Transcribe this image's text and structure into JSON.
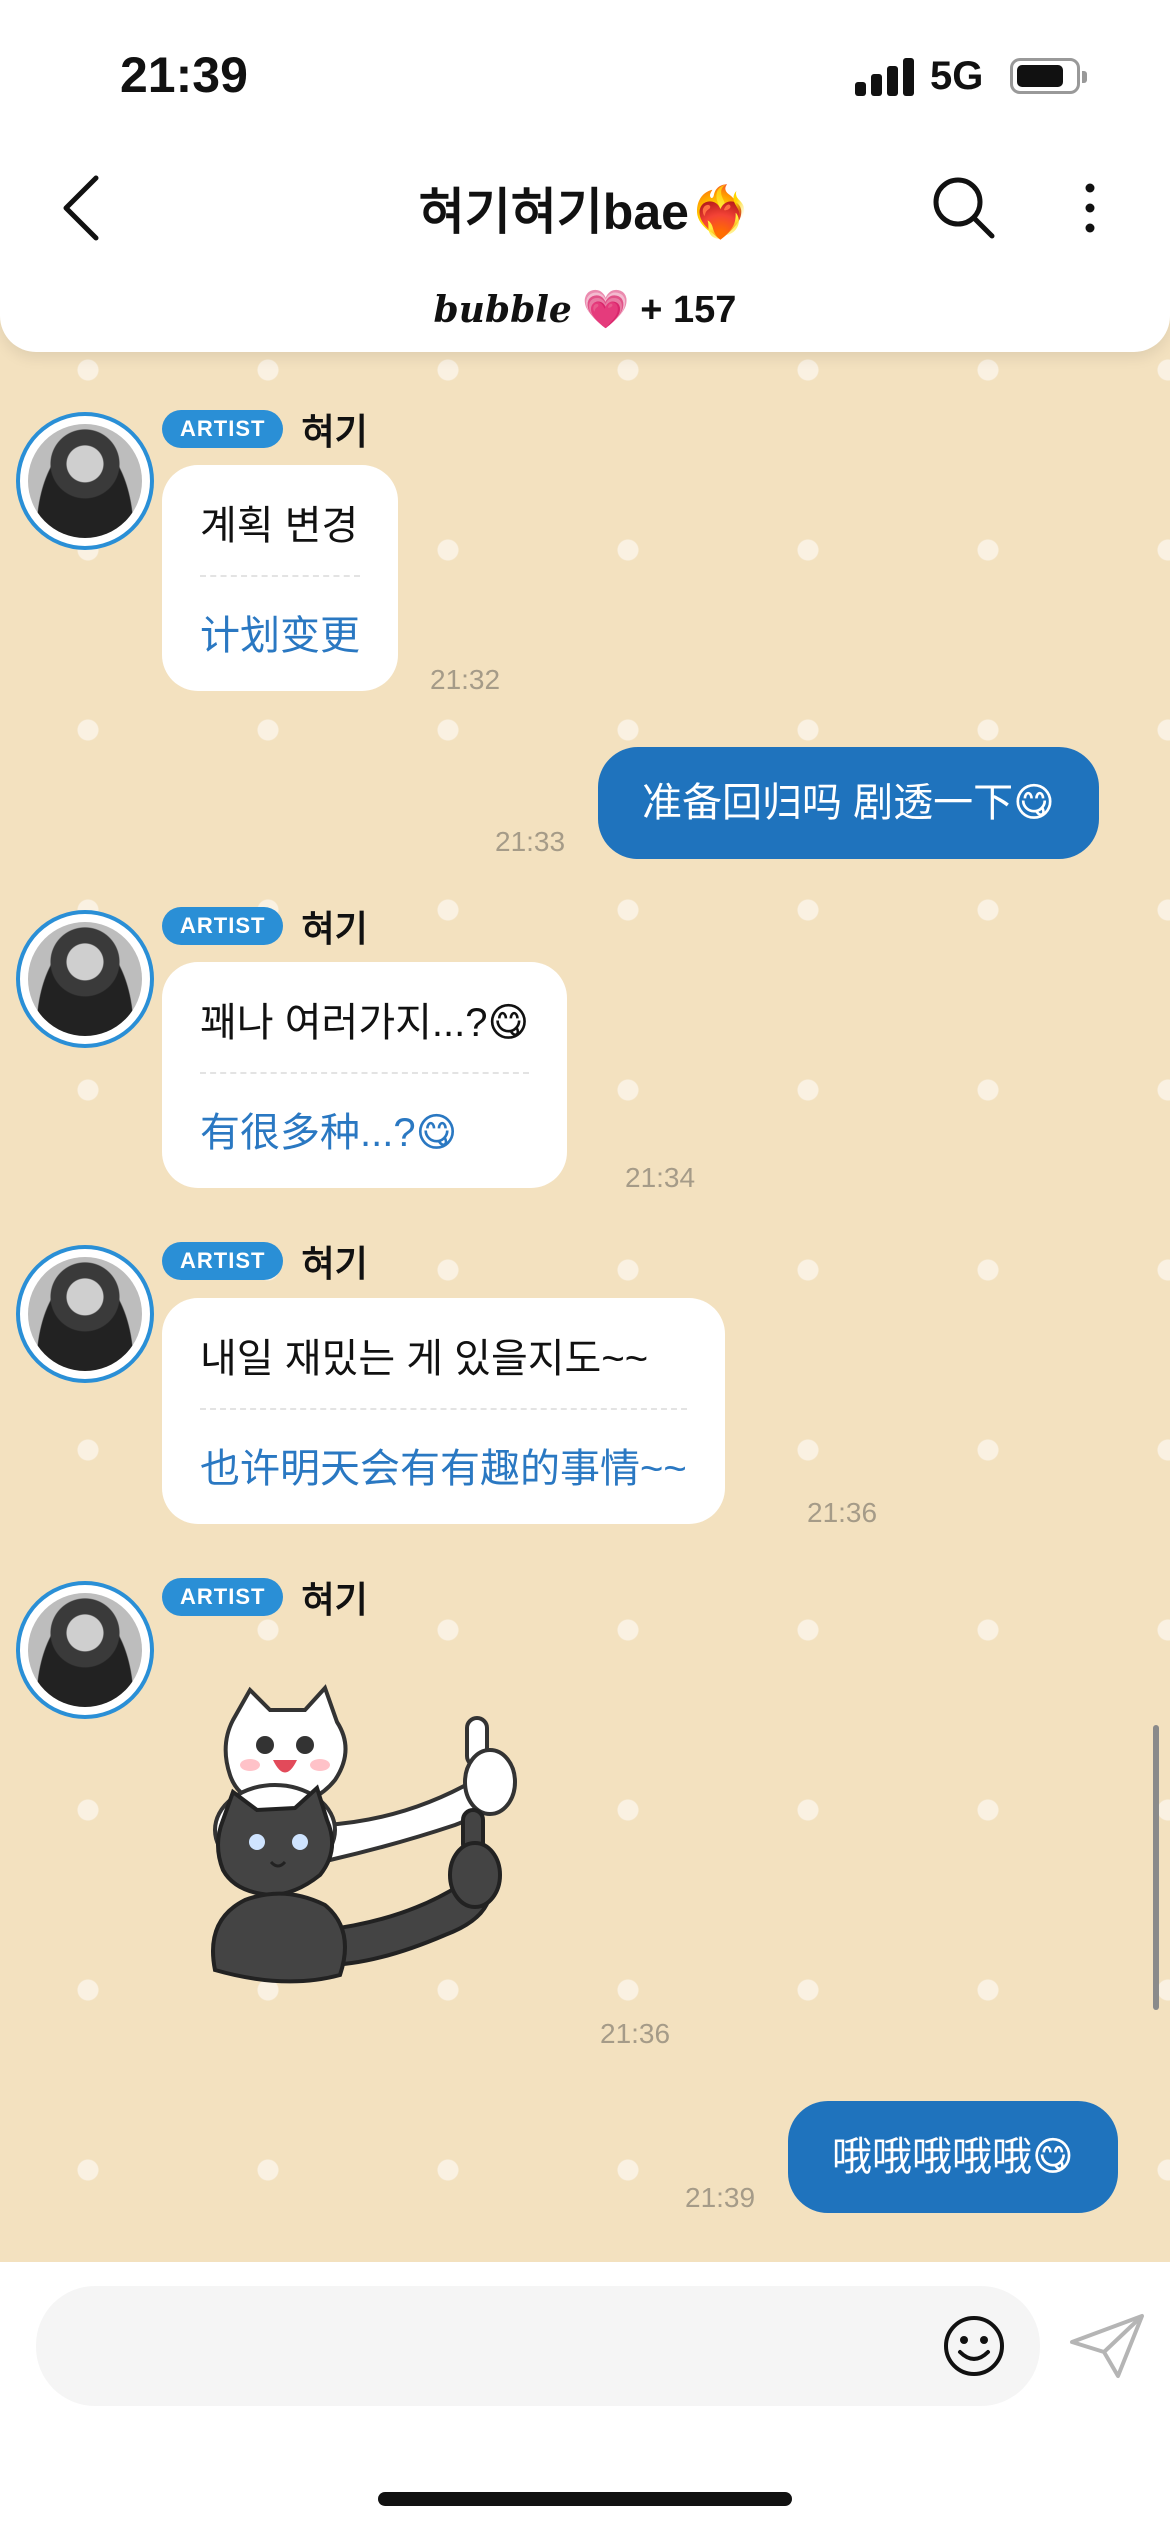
{
  "status": {
    "time": "21:39",
    "network": "5G"
  },
  "header": {
    "title": "혀기혀기bae❤️‍🔥",
    "subtitle_logo": "bubble",
    "subtitle_heart": "💗",
    "subtitle_count": "+ 157"
  },
  "artist": {
    "badge": "ARTIST",
    "name": "혀기"
  },
  "messages": [
    {
      "ko": "계획 변경",
      "zh": "计划变更",
      "time": "21:32"
    },
    {
      "out": "准备回归吗 剧透一下😋",
      "time": "21:33"
    },
    {
      "ko": "꽤나 여러가지...?😋",
      "zh": "有很多种...?😋",
      "time": "21:34"
    },
    {
      "ko": "내일 재밌는 게 있을지도~~",
      "zh": "也许明天会有有趣的事情~~",
      "time": "21:36"
    },
    {
      "sticker": "two-cats-thumbs-up",
      "time": "21:36"
    },
    {
      "out": "哦哦哦哦哦😋",
      "time": "21:39"
    }
  ],
  "input": {
    "placeholder": ""
  },
  "colors": {
    "accent": "#1f73bd",
    "background": "#f3e1bf",
    "translation": "#2a78c2"
  }
}
